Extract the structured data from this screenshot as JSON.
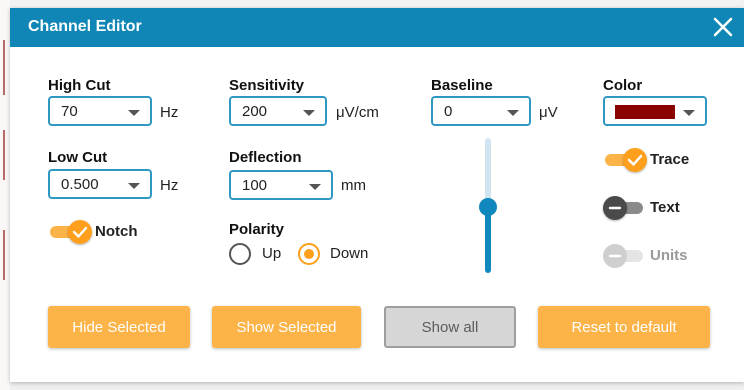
{
  "dialog": {
    "title": "Channel Editor",
    "close_icon": "close-icon"
  },
  "colors": {
    "accent": "#0f86b5",
    "orange": "#fcb348",
    "swatch": "#8b0000",
    "slider": "#1188bd"
  },
  "high_cut": {
    "label": "High Cut",
    "value": "70",
    "unit": "Hz"
  },
  "low_cut": {
    "label": "Low Cut",
    "value": "0.500",
    "unit": "Hz"
  },
  "notch": {
    "label": "Notch",
    "on": true
  },
  "sensitivity": {
    "label": "Sensitivity",
    "value": "200",
    "unit": "μV/cm"
  },
  "deflection": {
    "label": "Deflection",
    "value": "100",
    "unit": "mm"
  },
  "polarity": {
    "label": "Polarity",
    "options": [
      "Up",
      "Down"
    ],
    "selected": "Down"
  },
  "baseline": {
    "label": "Baseline",
    "value": "0",
    "unit": "μV",
    "slider_level": 0.5
  },
  "color": {
    "label": "Color",
    "value": "#8b0000"
  },
  "trace": {
    "label": "Trace",
    "on": true
  },
  "text": {
    "label": "Text",
    "on": false
  },
  "units": {
    "label": "Units",
    "on": false,
    "disabled": true
  },
  "buttons": {
    "hide_selected": "Hide Selected",
    "show_selected": "Show Selected",
    "show_all": "Show all",
    "reset": "Reset to default"
  }
}
